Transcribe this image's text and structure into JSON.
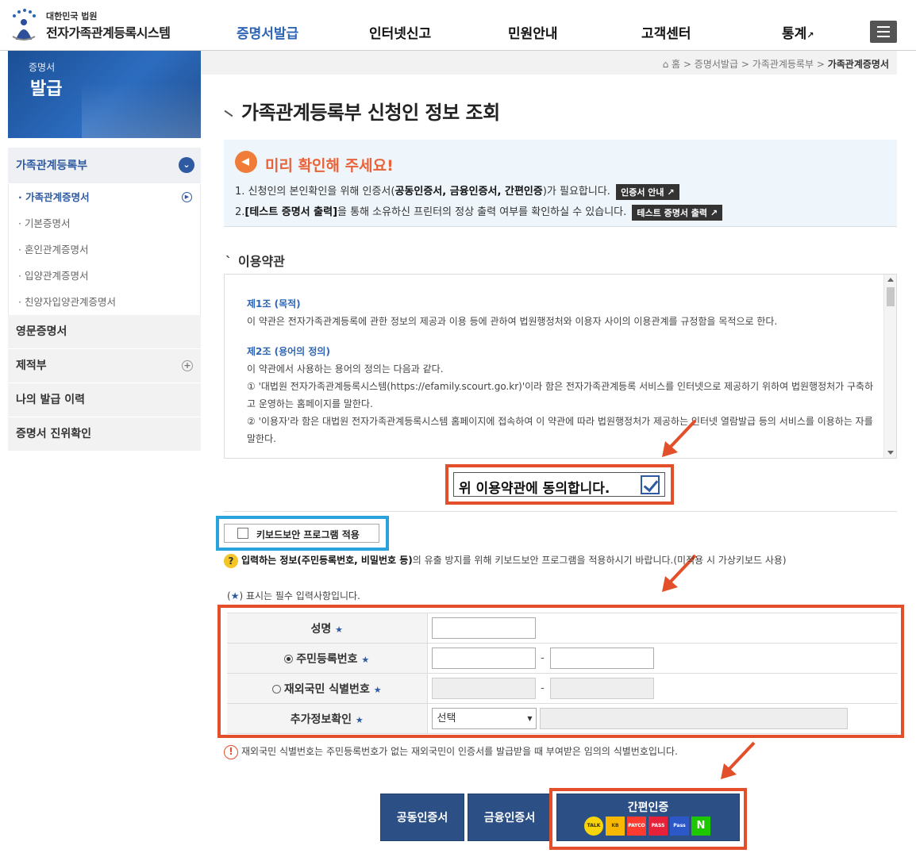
{
  "header": {
    "logo_small": "대한민국 법원",
    "logo_big": "전자가족관계등록시스템",
    "nav": [
      {
        "label": "증명서발급",
        "active": true
      },
      {
        "label": "인터넷신고",
        "active": false
      },
      {
        "label": "민원안내",
        "active": false
      },
      {
        "label": "고객센터",
        "active": false
      },
      {
        "label": "통계",
        "active": false
      }
    ],
    "external_mark": "↗"
  },
  "banner": {
    "line1": "증명서",
    "line2": "발급"
  },
  "sidebar": {
    "categories": [
      {
        "label": "가족관계등록부",
        "open": true,
        "items": [
          "· 가족관계증명서",
          "· 기본증명서",
          "· 혼인관계증명서",
          "· 입양관계증명서",
          "· 친양자입양관계증명서"
        ]
      },
      {
        "label": "영문증명서"
      },
      {
        "label": "제적부"
      },
      {
        "label": "나의 발급 이력"
      },
      {
        "label": "증명서 진위확인"
      }
    ]
  },
  "breadcrumb": {
    "home": "홈",
    "sep": ">",
    "level1": "증명서발급",
    "level2": "가족관계등록부",
    "current": "가족관계증명서"
  },
  "page": {
    "title": "가족관계등록부 신청인 정보 조회"
  },
  "notice": {
    "title": "미리 확인해 주세요!",
    "line1_pre": "1. 신청인의 본인확인을 위해 인증서(",
    "line1_bold": "공동인증서, 금융인증서, 간편인증",
    "line1_post": ")가 필요합니다.",
    "line1_btn": "인증서 안내 ↗",
    "line2_pre": "2.",
    "line2_bold": "[테스트 증명서 출력]",
    "line2_post": "을 통해 소유하신 프린터의 정상 출력 여부를 확인하실 수 있습니다.",
    "line2_btn": "테스트 증명서 출력 ↗"
  },
  "terms": {
    "title": "이용약관",
    "art1_title": "제1조 (목적)",
    "art1_body": "이 약관은 전자가족관계등록에 관한 정보의 제공과 이용 등에 관하여 법원행정처와 이용자 사이의 이용관계를 규정함을 목적으로 한다.",
    "art2_title": "제2조 (용어의 정의)",
    "art2_body": "이 약관에서 사용하는 용어의 정의는 다음과 같다.",
    "art2_item1": "① '대법원 전자가족관계등록시스템(https://efamily.scourt.go.kr)'이라 함은 전자가족관계등록 서비스를 인터넷으로 제공하기 위하여 법원행정처가 구축하고 운영하는 홈페이지를 말한다.",
    "art2_item2": "② '이용자'라 함은 대법원 전자가족관계등록시스템 홈페이지에 접속하여 이 약관에 따라 법원행정처가 제공하는 인터넷 열람발급 등의 서비스를 이용하는 자를 말한다.",
    "agree_label": "위 이용약관에 동의합니다.",
    "agree_checked": true
  },
  "keyboard": {
    "label": "키보드보안 프로그램 적용",
    "help_pre": "입력하는 정보(주민등록번호, 비밀번호 등)",
    "help_post": "의 유출 방지를 위해 키보드보안 프로그램을 적용하시기 바랍니다.(미적용 시 가상키보드 사용)"
  },
  "form": {
    "required_note_pre": "(",
    "required_note_star": "★",
    "required_note_post": ") 표시는 필수 입력사항입니다.",
    "star": "★",
    "name_label": "성명",
    "rrn_label": "주민등록번호",
    "foreign_label": "재외국민 식별번호",
    "extra_label": "추가정보확인",
    "extra_select": "선택",
    "dash": "-",
    "warn": "재외국민 식별번호는 주민등록번호가 없는 재외국민이 인증서를 발급받을 때 부여받은 임의의 식별번호입니다."
  },
  "buttons": {
    "common_cert": "공동인증서",
    "finance_cert": "금융인증서",
    "simple_cert": "간편인증",
    "providers": [
      "TALK",
      "KB",
      "PAYCO",
      "PASS",
      "Pass",
      "N"
    ]
  },
  "colors": {
    "primary": "#2d66b6",
    "navy_button": "#2c4f86",
    "highlight_red": "#e24f2a",
    "highlight_blue": "#2aa3dc",
    "notice_orange": "#e8633a"
  }
}
